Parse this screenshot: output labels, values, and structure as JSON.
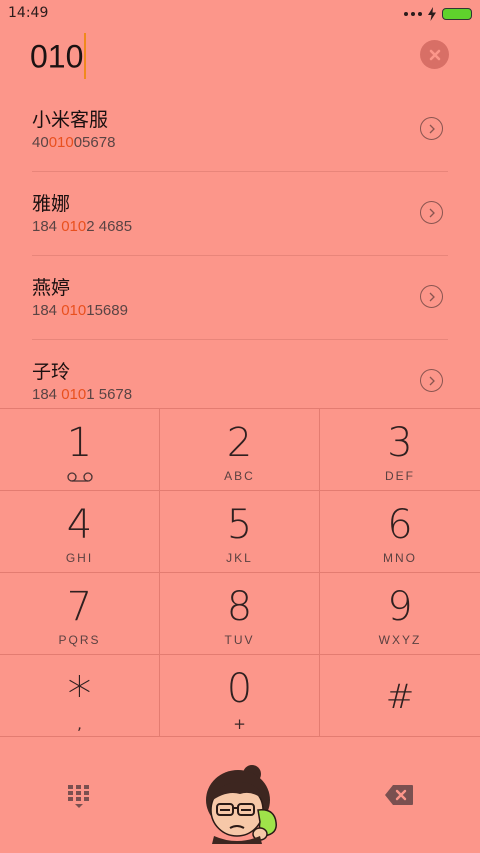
{
  "status_bar": {
    "time": "14:49"
  },
  "dialer": {
    "input": "010"
  },
  "contacts": [
    {
      "name": "小米客服",
      "number_before": "40",
      "number_match": "010",
      "number_after": "05678"
    },
    {
      "name": "雅娜",
      "number_before": "184 ",
      "number_match": "010",
      "number_after": "2 4685"
    },
    {
      "name": "燕婷",
      "number_before": "184 ",
      "number_match": "010",
      "number_after": "15689"
    },
    {
      "name": "子玲",
      "number_before": "184 ",
      "number_match": "010",
      "number_after": "1 5678"
    }
  ],
  "keypad": [
    {
      "digit": "1",
      "letters": ""
    },
    {
      "digit": "2",
      "letters": "ABC"
    },
    {
      "digit": "3",
      "letters": "DEF"
    },
    {
      "digit": "4",
      "letters": "GHI"
    },
    {
      "digit": "5",
      "letters": "JKL"
    },
    {
      "digit": "6",
      "letters": "MNO"
    },
    {
      "digit": "7",
      "letters": "PQRS"
    },
    {
      "digit": "8",
      "letters": "TUV"
    },
    {
      "digit": "9",
      "letters": "WXYZ"
    },
    {
      "digit": "*",
      "letters": ","
    },
    {
      "digit": "0",
      "letters": "+"
    },
    {
      "digit": "#",
      "letters": ""
    }
  ],
  "icons": {
    "voicemail": "voicemail-icon",
    "clear": "clear-input-icon",
    "contact_detail": "chevron-right-circle-icon",
    "dialpad": "dialpad-icon",
    "call": "call-avatar-icon",
    "backspace": "backspace-icon"
  },
  "colors": {
    "background": "#fc968a",
    "match_highlight": "#e9501e",
    "caret": "#f08a1c",
    "battery": "#5fd22c"
  }
}
